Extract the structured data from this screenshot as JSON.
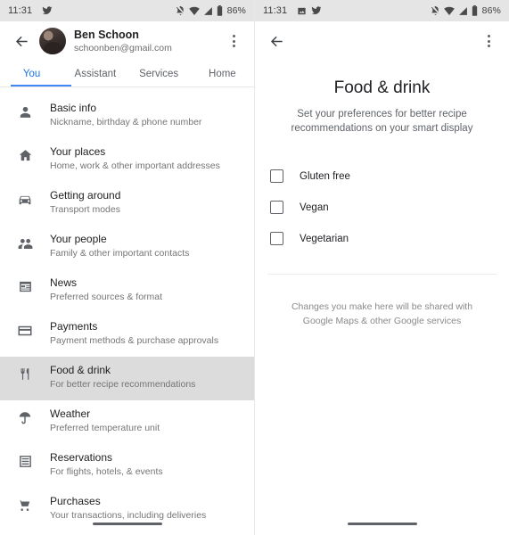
{
  "left_phone": {
    "statusbar": {
      "time": "11:31",
      "left_icons": [
        "twitter-icon"
      ],
      "right_icons": [
        "notifications-off-icon",
        "wifi-icon",
        "signal-icon",
        "battery-icon"
      ],
      "battery": "86%"
    },
    "appbar": {
      "back_icon": "back-arrow-icon",
      "avatar": "profile-avatar",
      "account_name": "Ben Schoon",
      "account_email": "schoonben@gmail.com",
      "overflow_icon": "more-options-icon"
    },
    "tabs": [
      {
        "label": "You",
        "active": true
      },
      {
        "label": "Assistant",
        "active": false
      },
      {
        "label": "Services",
        "active": false
      },
      {
        "label": "Home",
        "active": false
      }
    ],
    "accent_color": "#1a73e8",
    "selected_row_color": "#dcdcdc",
    "list": [
      {
        "icon": "person-icon",
        "title": "Basic info",
        "subtitle": "Nickname, birthday & phone number",
        "selected": false
      },
      {
        "icon": "home-icon",
        "title": "Your places",
        "subtitle": "Home, work & other important addresses",
        "selected": false
      },
      {
        "icon": "car-icon",
        "title": "Getting around",
        "subtitle": "Transport modes",
        "selected": false
      },
      {
        "icon": "people-icon",
        "title": "Your people",
        "subtitle": "Family & other important contacts",
        "selected": false
      },
      {
        "icon": "news-icon",
        "title": "News",
        "subtitle": "Preferred sources & format",
        "selected": false
      },
      {
        "icon": "credit-card-icon",
        "title": "Payments",
        "subtitle": "Payment methods & purchase approvals",
        "selected": false
      },
      {
        "icon": "restaurant-icon",
        "title": "Food & drink",
        "subtitle": "For better recipe recommendations",
        "selected": true
      },
      {
        "icon": "weather-icon",
        "title": "Weather",
        "subtitle": "Preferred temperature unit",
        "selected": false
      },
      {
        "icon": "reservations-icon",
        "title": "Reservations",
        "subtitle": "For flights, hotels, & events",
        "selected": false
      },
      {
        "icon": "cart-icon",
        "title": "Purchases",
        "subtitle": "Your transactions, including deliveries",
        "selected": false
      }
    ],
    "gesture_bar": "home-gesture-bar"
  },
  "right_phone": {
    "statusbar": {
      "time": "11:31",
      "left_icons": [
        "image-icon",
        "twitter-icon"
      ],
      "right_icons": [
        "notifications-off-icon",
        "wifi-icon",
        "signal-icon",
        "battery-icon"
      ],
      "battery": "86%"
    },
    "appbar": {
      "back_icon": "back-arrow-icon",
      "overflow_icon": "more-options-icon"
    },
    "title": "Food & drink",
    "subtitle": "Set your preferences for better recipe recommendations on your smart display",
    "checkboxes": [
      {
        "label": "Gluten free",
        "checked": false
      },
      {
        "label": "Vegan",
        "checked": false
      },
      {
        "label": "Vegetarian",
        "checked": false
      }
    ],
    "footnote": "Changes you make here will be shared with Google Maps & other Google services",
    "gesture_bar": "home-gesture-bar"
  }
}
